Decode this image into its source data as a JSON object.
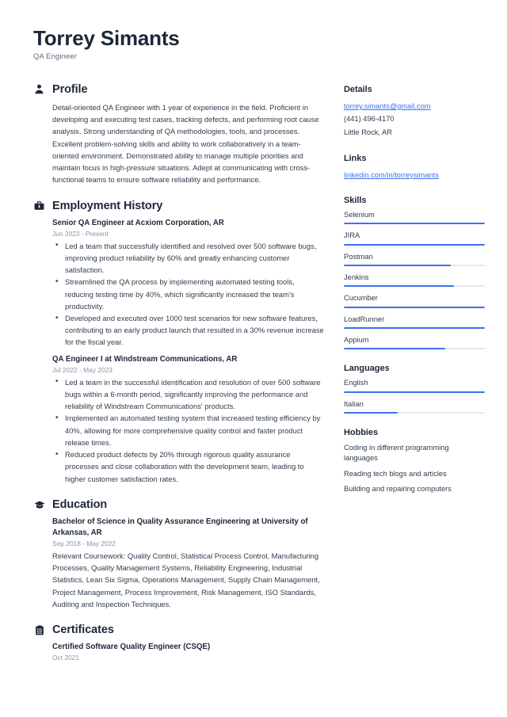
{
  "header": {
    "name": "Torrey Simants",
    "job_title": "QA Engineer"
  },
  "accent_color": "#3d71f0",
  "text_color": "#313c4d",
  "heading_color": "#1d2738",
  "muted_color": "#8a94a3",
  "track_color": "#e6e8eb",
  "main": {
    "profile": {
      "icon": "user-icon",
      "title": "Profile",
      "text": "Detail-oriented QA Engineer with 1 year of experience in the field. Proficient in developing and executing test cases, tracking defects, and performing root cause analysis. Strong understanding of QA methodologies, tools, and processes. Excellent problem-solving skills and ability to work collaboratively in a team-oriented environment. Demonstrated ability to manage multiple priorities and maintain focus in high-pressure situations. Adept at communicating with cross-functional teams to ensure software reliability and performance."
    },
    "employment": {
      "icon": "briefcase-icon",
      "title": "Employment History",
      "entries": [
        {
          "title": "Senior QA Engineer at Acxiom Corporation, AR",
          "date": "Jun 2023 - Present",
          "bullets": [
            "Led a team that successfully identified and resolved over 500 software bugs, improving product reliability by 60% and greatly enhancing customer satisfaction.",
            "Streamlined the QA process by implementing automated testing tools, reducing testing time by 40%, which significantly increased the team's productivity.",
            "Developed and executed over 1000 test scenarios for new software features, contributing to an early product launch that resulted in a 30% revenue increase for the fiscal year."
          ]
        },
        {
          "title": "QA Engineer I at Windstream Communications, AR",
          "date": "Jul 2022 - May 2023",
          "bullets": [
            "Led a team in the successful identification and resolution of over 500 software bugs within a 6-month period, significantly improving the performance and reliability of Windstream Communications' products.",
            "Implemented an automated testing system that increased testing efficiency by 40%, allowing for more comprehensive quality control and faster product release times.",
            "Reduced product defects by 20% through rigorous quality assurance processes and close collaboration with the development team, leading to higher customer satisfaction rates."
          ]
        }
      ]
    },
    "education": {
      "icon": "graduation-cap-icon",
      "title": "Education",
      "entries": [
        {
          "title": "Bachelor of Science in Quality Assurance Engineering at University of Arkansas, AR",
          "date": "Sep 2018 - May 2022",
          "description": "Relevant Coursework: Quality Control, Statistical Process Control, Manufacturing Processes, Quality Management Systems, Reliability Engineering, Industrial Statistics, Lean Six Sigma, Operations Management, Supply Chain Management, Project Management, Process Improvement, Risk Management, ISO Standards, Auditing and Inspection Techniques."
        }
      ]
    },
    "certificates": {
      "icon": "certificate-icon",
      "title": "Certificates",
      "entries": [
        {
          "title": "Certified Software Quality Engineer (CSQE)",
          "date": "Oct 2021"
        }
      ]
    }
  },
  "sidebar": {
    "details": {
      "title": "Details",
      "email": "torrey.simants@gmail.com",
      "phone": "(441) 496-4170",
      "location": "Little Rock, AR"
    },
    "links": {
      "title": "Links",
      "items": [
        {
          "label": "linkedin.com/in/torreysimants"
        }
      ]
    },
    "skills": {
      "title": "Skills",
      "items": [
        {
          "label": "Selenium",
          "level": 100
        },
        {
          "label": "JIRA",
          "level": 100
        },
        {
          "label": "Postman",
          "level": 76
        },
        {
          "label": "Jenkins",
          "level": 78
        },
        {
          "label": "Cucumber",
          "level": 100
        },
        {
          "label": "LoadRunner",
          "level": 100
        },
        {
          "label": "Appium",
          "level": 72
        }
      ]
    },
    "languages": {
      "title": "Languages",
      "items": [
        {
          "label": "English",
          "level": 100
        },
        {
          "label": "Italian",
          "level": 38
        }
      ]
    },
    "hobbies": {
      "title": "Hobbies",
      "items": [
        {
          "label": "Coding in different programming languages"
        },
        {
          "label": "Reading tech blogs and articles"
        },
        {
          "label": "Building and repairing computers"
        }
      ]
    }
  }
}
